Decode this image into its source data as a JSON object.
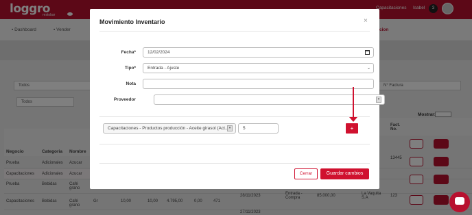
{
  "app": {
    "logo": "loggro",
    "logo_sub": "restobar",
    "user_company": "Capacitaciones",
    "user_name": "Isabel",
    "notification_count": "3"
  },
  "nav": {
    "items": [
      "Dashboard",
      "Vender"
    ],
    "active_fragment": "cion"
  },
  "filters": {
    "search_value": "Todos",
    "select_value": "Todos",
    "invoice_placeholder": "N° Factura"
  },
  "table": {
    "headers": [
      "Negocio",
      "Categoria",
      "Nombre"
    ],
    "right_headers": [
      "Fact. No."
    ],
    "rows": [
      {
        "negocio": "Prueba",
        "categoria": "Adicionales",
        "nombre": "Azucar",
        "fact": "13445"
      },
      {
        "negocio": "Capacitaciones",
        "categoria": "Adicionales",
        "nombre": "Azucar",
        "fact": ""
      },
      {
        "negocio": "Prueba",
        "categoria": "Bebidas",
        "nombre": "Café grano",
        "fact": ""
      },
      {
        "negocio": "Capacitaciones",
        "categoria": "Bebidas",
        "nombre": "Café grano",
        "fact": "123"
      }
    ],
    "row4_extra": [
      "Gr",
      "10,00",
      "10,00",
      "4.795,00",
      "0,00",
      "471"
    ],
    "right_row4": {
      "fecha": "28/11/2023",
      "tipo": "Entrada - Compra",
      "monto": "85.000,00",
      "proveedor": "La Vaquita S.A"
    },
    "right_row5": {
      "fecha": "27/11/2023"
    },
    "mostrar_label": "Mostrar:"
  },
  "modal": {
    "title": "Movimiento Inventario",
    "close_glyph": "×",
    "fields": {
      "fecha": {
        "label": "Fecha*",
        "value": "12/02/2024"
      },
      "tipo": {
        "label": "Tipo*",
        "value": "Entrada - Ajuste"
      },
      "nota": {
        "label": "Nota",
        "value": ""
      },
      "proveedor": {
        "label": "Proveedor",
        "value": ""
      }
    },
    "product_line": {
      "product": "Capacitaciones - Productos producción - Aceite girasol (Act...",
      "quantity": "5",
      "add_label": "+"
    },
    "buttons": {
      "cerrar": "Cerrar",
      "guardar": "Guardar cambios"
    }
  },
  "colors": {
    "brand": "#b8112f",
    "accent": "#d0112f"
  }
}
